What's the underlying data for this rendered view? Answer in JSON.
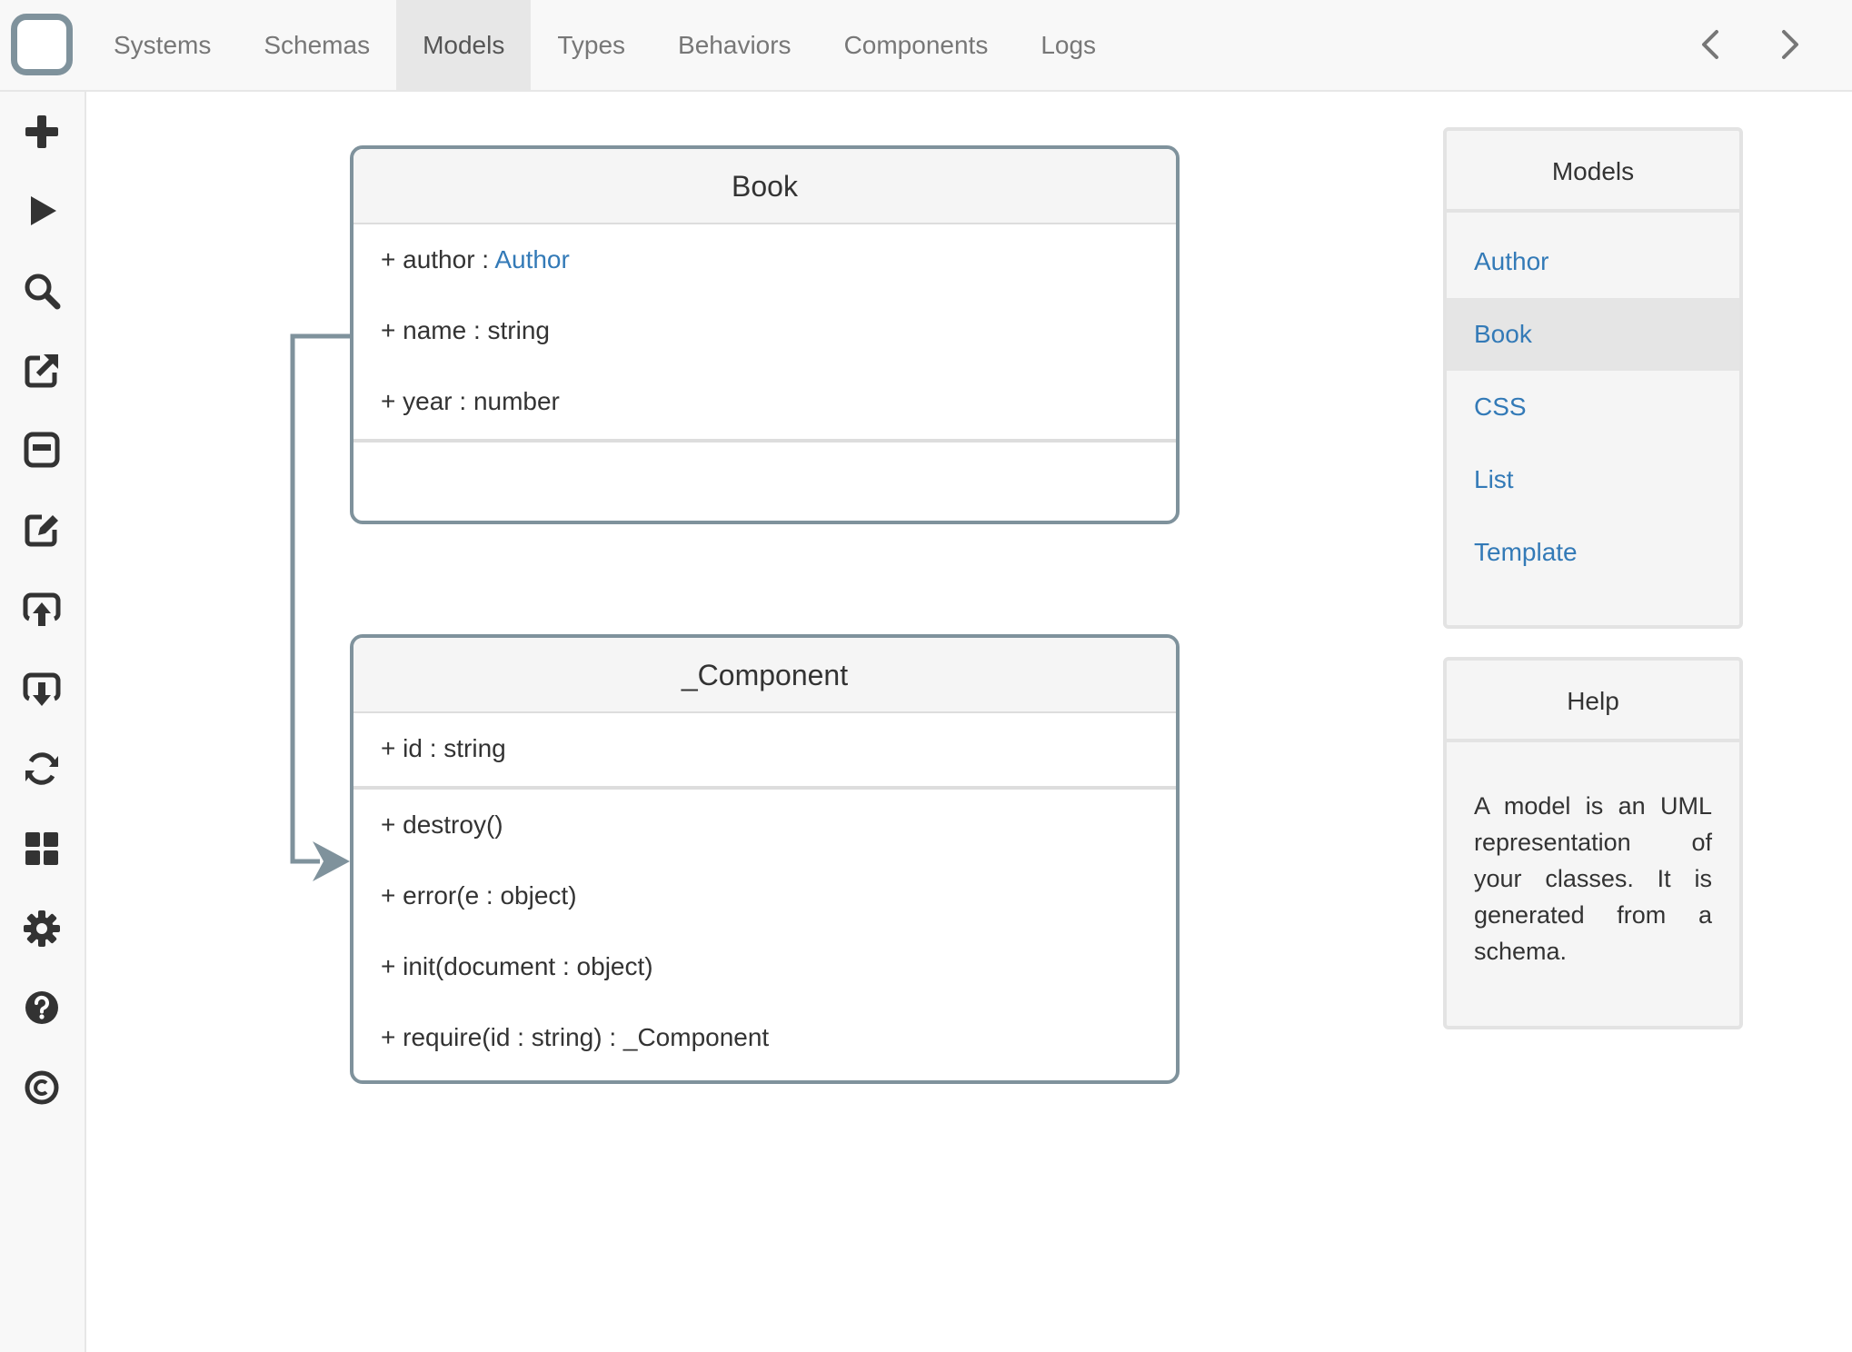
{
  "nav": {
    "tabs": [
      {
        "label": "Systems"
      },
      {
        "label": "Schemas"
      },
      {
        "label": "Models",
        "active": true
      },
      {
        "label": "Types"
      },
      {
        "label": "Behaviors"
      },
      {
        "label": "Components"
      },
      {
        "label": "Logs"
      }
    ],
    "back_icon": "chevron-left-icon",
    "forward_icon": "chevron-right-icon"
  },
  "sidebar": {
    "icons": [
      "plus-icon",
      "play-icon",
      "search-icon",
      "external-link-icon",
      "window-icon",
      "edit-icon",
      "upload-icon",
      "download-icon",
      "refresh-icon",
      "dashboard-icon",
      "gear-icon",
      "help-icon",
      "copyright-icon"
    ]
  },
  "diagram": {
    "book": {
      "title": "Book",
      "attributes": [
        {
          "prefix": "+ author : ",
          "type": "Author"
        },
        {
          "text": "+ name : string"
        },
        {
          "text": "+ year : number"
        }
      ]
    },
    "component": {
      "title": "_Component",
      "attributes": [
        "+ id : string"
      ],
      "methods": [
        "+ destroy()",
        "+ error(e : object)",
        "+ init(document : object)",
        "+ require(id : string) : _Component"
      ]
    }
  },
  "models_panel": {
    "title": "Models",
    "items": [
      "Author",
      "Book",
      "CSS",
      "List",
      "Template"
    ],
    "selected": "Book"
  },
  "help_panel": {
    "title": "Help",
    "text": "A model is an UML representation of your classes. It is generated from a schema."
  },
  "colors": {
    "border": "#7f929c",
    "link": "#337ab7",
    "active_tab": "#e7e7e7"
  }
}
